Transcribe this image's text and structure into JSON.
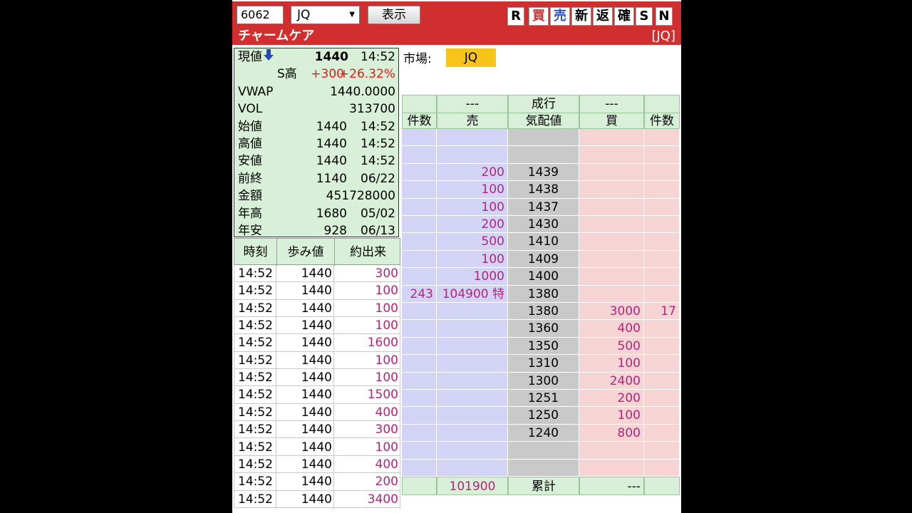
{
  "header": {
    "code": "6062",
    "market_select": "JQ",
    "show_label": "表示",
    "tools": [
      "R",
      "買",
      "売",
      "新",
      "返",
      "確",
      "S",
      "N"
    ],
    "stock_name": "チャームケア",
    "market_tag": "[JQ]"
  },
  "quote": {
    "price_label": "現値",
    "price": "1440",
    "price_time": "14:52",
    "status": "S高",
    "change": "+300",
    "change_pct": "+26.32%",
    "vwap_label": "VWAP",
    "vwap": "1440.0000",
    "vol_label": "VOL",
    "vol": "313700",
    "open_label": "始値",
    "open": "1440",
    "open_time": "14:52",
    "high_label": "高値",
    "high": "1440",
    "high_time": "14:52",
    "low_label": "安値",
    "low": "1440",
    "low_time": "14:52",
    "prev_label": "前終",
    "prev": "1140",
    "prev_date": "06/22",
    "amount_label": "金額",
    "amount": "451728000",
    "yhigh_label": "年高",
    "yhigh": "1680",
    "yhigh_date": "05/02",
    "ylow_label": "年安",
    "ylow": "928",
    "ylow_date": "06/13"
  },
  "ticks": {
    "headers": [
      "時刻",
      "歩み値",
      "約出来"
    ],
    "rows": [
      [
        "14:52",
        "1440",
        "300"
      ],
      [
        "14:52",
        "1440",
        "100"
      ],
      [
        "14:52",
        "1440",
        "100"
      ],
      [
        "14:52",
        "1440",
        "100"
      ],
      [
        "14:52",
        "1440",
        "1600"
      ],
      [
        "14:52",
        "1440",
        "100"
      ],
      [
        "14:52",
        "1440",
        "100"
      ],
      [
        "14:52",
        "1440",
        "1500"
      ],
      [
        "14:52",
        "1440",
        "400"
      ],
      [
        "14:52",
        "1440",
        "300"
      ],
      [
        "14:52",
        "1440",
        "100"
      ],
      [
        "14:52",
        "1440",
        "400"
      ],
      [
        "14:52",
        "1440",
        "200"
      ],
      [
        "14:52",
        "1440",
        "3400"
      ]
    ]
  },
  "market": {
    "label": "市場:",
    "value": "JQ"
  },
  "book": {
    "head_top": [
      "",
      "---",
      "成行",
      "---",
      ""
    ],
    "head_bot": [
      "件数",
      "売",
      "気配値",
      "買",
      "件数"
    ],
    "rows": [
      [
        "",
        "",
        "",
        "",
        ""
      ],
      [
        "",
        "",
        "",
        "",
        ""
      ],
      [
        "",
        "200",
        "1439",
        "",
        ""
      ],
      [
        "",
        "100",
        "1438",
        "",
        ""
      ],
      [
        "",
        "100",
        "1437",
        "",
        ""
      ],
      [
        "",
        "200",
        "1430",
        "",
        ""
      ],
      [
        "",
        "500",
        "1410",
        "",
        ""
      ],
      [
        "",
        "100",
        "1409",
        "",
        ""
      ],
      [
        "",
        "1000",
        "1400",
        "",
        ""
      ],
      [
        "243",
        "104900 特",
        "1380",
        "",
        ""
      ],
      [
        "",
        "",
        "1380",
        "3000",
        "17"
      ],
      [
        "",
        "",
        "1360",
        "400",
        ""
      ],
      [
        "",
        "",
        "1350",
        "500",
        ""
      ],
      [
        "",
        "",
        "1310",
        "100",
        ""
      ],
      [
        "",
        "",
        "1300",
        "2400",
        ""
      ],
      [
        "",
        "",
        "1251",
        "200",
        ""
      ],
      [
        "",
        "",
        "1250",
        "100",
        ""
      ],
      [
        "",
        "",
        "1240",
        "800",
        ""
      ],
      [
        "",
        "",
        "",
        "",
        ""
      ],
      [
        "",
        "",
        "",
        "",
        ""
      ]
    ],
    "foot": [
      "",
      "101900",
      "累計",
      "---",
      ""
    ]
  },
  "colors": {
    "header_red": "#d12f2f",
    "panel_green": "#d7f0d7",
    "ask_blue": "#d3d3f5",
    "bid_pink": "#f7d4d4",
    "magenta": "#b4247a",
    "market_yellow": "#f5c518"
  }
}
